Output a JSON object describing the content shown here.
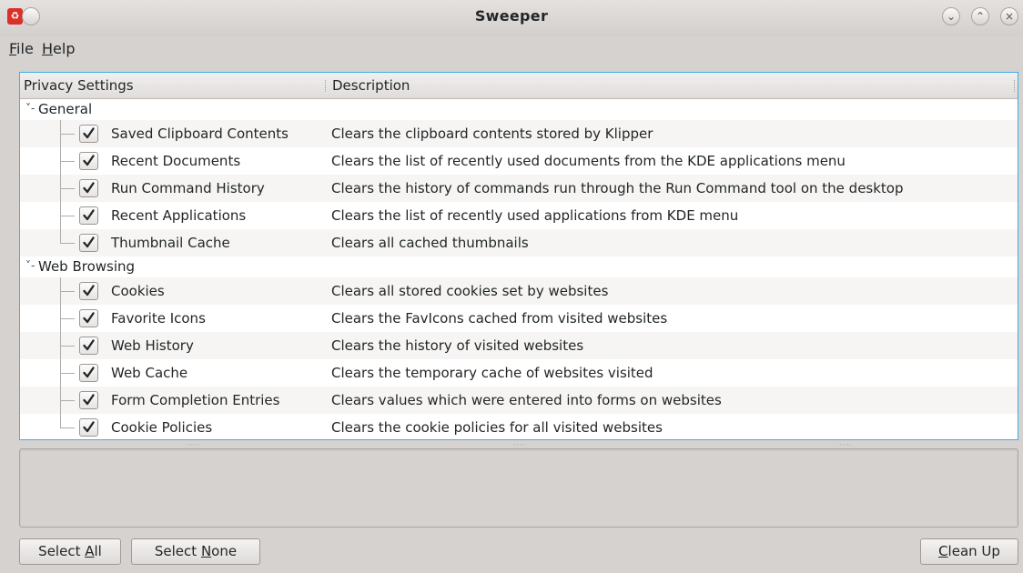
{
  "window": {
    "title": "Sweeper",
    "app_icon": "sweeper-app-icon",
    "menu_button_icon": "window-menu-icon",
    "minimize_icon": "chevron-down-icon",
    "maximize_icon": "chevron-up-icon",
    "close_icon": "close-icon"
  },
  "menubar": {
    "file": {
      "mnemonic": "F",
      "rest": "ile"
    },
    "help": {
      "mnemonic": "H",
      "rest": "elp"
    }
  },
  "tree": {
    "columns": [
      "Privacy Settings",
      "Description"
    ],
    "groups": [
      {
        "label": "General",
        "expanded": true,
        "items": [
          {
            "label": "Saved Clipboard Contents",
            "description": "Clears the clipboard contents stored by Klipper",
            "checked": true
          },
          {
            "label": "Recent Documents",
            "description": "Clears the list of recently used documents from the KDE applications menu",
            "checked": true
          },
          {
            "label": "Run Command History",
            "description": "Clears the history of commands run through the Run Command tool on the desktop",
            "checked": true
          },
          {
            "label": "Recent Applications",
            "description": "Clears the list of recently used applications from KDE menu",
            "checked": true
          },
          {
            "label": "Thumbnail Cache",
            "description": "Clears all cached thumbnails",
            "checked": true
          }
        ]
      },
      {
        "label": "Web Browsing",
        "expanded": true,
        "items": [
          {
            "label": "Cookies",
            "description": "Clears all stored cookies set by websites",
            "checked": true
          },
          {
            "label": "Favorite Icons",
            "description": "Clears the FavIcons cached from visited websites",
            "checked": true
          },
          {
            "label": "Web History",
            "description": "Clears the history of visited websites",
            "checked": true
          },
          {
            "label": "Web Cache",
            "description": "Clears the temporary cache of websites visited",
            "checked": true
          },
          {
            "label": "Form Completion Entries",
            "description": "Clears values which were entered into forms on websites",
            "checked": true
          },
          {
            "label": "Cookie Policies",
            "description": "Clears the cookie policies for all visited websites",
            "checked": true
          }
        ]
      }
    ]
  },
  "buttons": {
    "select_all": {
      "before": "Select ",
      "mnemonic": "A",
      "after": "ll"
    },
    "select_none": {
      "before": "Select ",
      "mnemonic": "N",
      "after": "one"
    },
    "clean_up": {
      "before": "",
      "mnemonic": "C",
      "after": "lean Up"
    }
  },
  "colors": {
    "focus_border": "#3daee9",
    "window_bg": "#d6d2d0",
    "accent_red": "#d9302c"
  }
}
